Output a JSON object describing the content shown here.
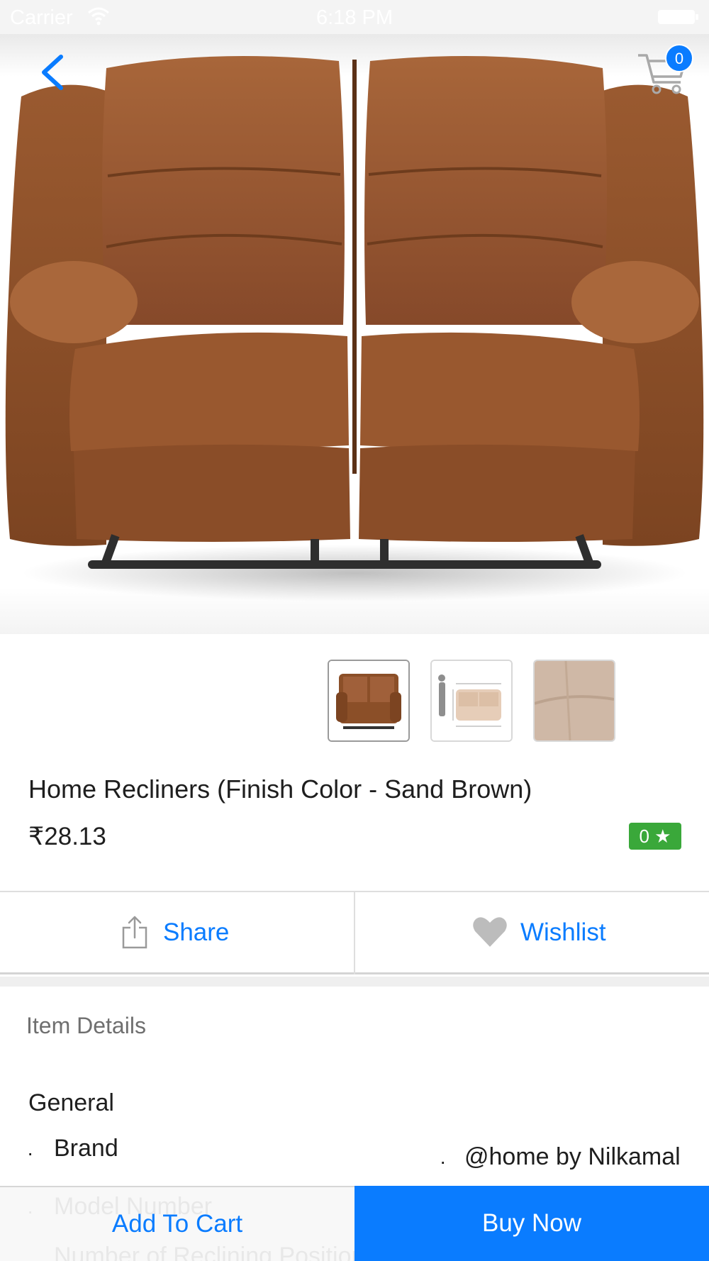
{
  "status_bar": {
    "carrier": "Carrier",
    "time": "6:18 PM"
  },
  "nav": {
    "back_icon": "chevron-left-icon",
    "cart_icon": "cart-icon",
    "cart_count": "0"
  },
  "gallery": {
    "images": [
      "sofa-front-photo",
      "sofa-dimensions-photo",
      "fabric-closeup-photo"
    ],
    "selected_index": 0
  },
  "product": {
    "title": "Home Recliners (Finish Color - Sand Brown)",
    "price": "₹28.13",
    "rating": "0 ★"
  },
  "actions": {
    "share_label": "Share",
    "wishlist_label": "Wishlist",
    "share_icon": "share-icon",
    "wishlist_icon": "heart-icon"
  },
  "details": {
    "header": "Item Details",
    "section": "General",
    "specs": [
      {
        "key": "Brand",
        "value": "@home by Nilkamal"
      },
      {
        "key": "Model Number",
        "value": ""
      },
      {
        "key": "Number of Reclining Positions",
        "value": ""
      }
    ],
    "bullet": "·"
  },
  "bottom_bar": {
    "add_to_cart_label": "Add To Cart",
    "buy_now_label": "Buy Now"
  },
  "colors": {
    "accent": "#0a7cff",
    "rating_green": "#3aa83a",
    "sofa_brown": "#8b4f28"
  }
}
